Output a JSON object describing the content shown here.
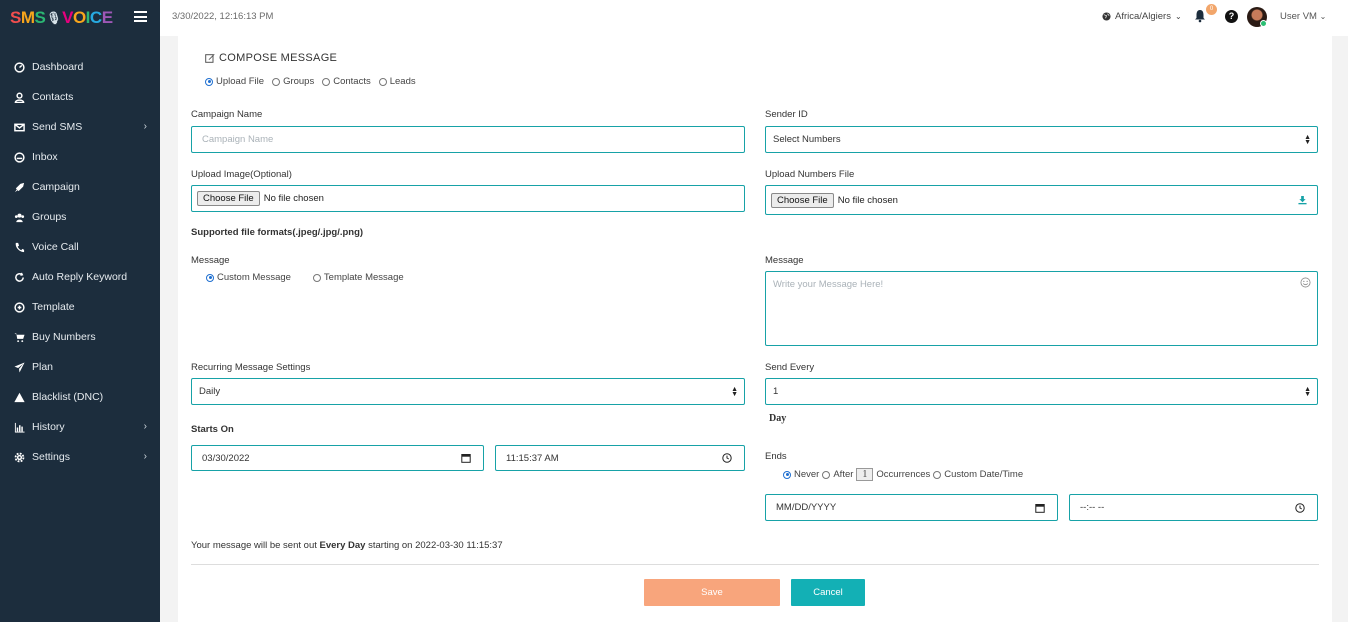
{
  "app": {
    "logo_letters": [
      "S",
      "M",
      "S",
      "V",
      "O",
      "I",
      "C",
      "E"
    ]
  },
  "header": {
    "datetime": "3/30/2022, 12:16:13 PM",
    "timezone": "Africa/Algiers",
    "notification_count": "0",
    "help_glyph": "?",
    "user_name": "User VM"
  },
  "sidebar": {
    "items": [
      {
        "label": "Dashboard",
        "icon": "dashboard-icon"
      },
      {
        "label": "Contacts",
        "icon": "user-icon"
      },
      {
        "label": "Send SMS",
        "icon": "envelope-icon",
        "chevron": "›"
      },
      {
        "label": "Inbox",
        "icon": "inbox-icon"
      },
      {
        "label": "Campaign",
        "icon": "rocket-icon"
      },
      {
        "label": "Groups",
        "icon": "users-icon"
      },
      {
        "label": "Voice Call",
        "icon": "phone-icon"
      },
      {
        "label": "Auto Reply Keyword",
        "icon": "refresh-icon"
      },
      {
        "label": "Template",
        "icon": "template-icon"
      },
      {
        "label": "Buy Numbers",
        "icon": "cart-icon"
      },
      {
        "label": "Plan",
        "icon": "paper-plane-icon"
      },
      {
        "label": "Blacklist (DNC)",
        "icon": "warning-icon"
      },
      {
        "label": "History",
        "icon": "bar-chart-icon",
        "chevron": "›"
      },
      {
        "label": "Settings",
        "icon": "gear-icon",
        "chevron": "›"
      }
    ]
  },
  "compose": {
    "title": "COMPOSE MESSAGE",
    "source_options": [
      "Upload File",
      "Groups",
      "Contacts",
      "Leads"
    ],
    "source_selected": "Upload File",
    "campaign_name_label": "Campaign Name",
    "campaign_name_placeholder": "Campaign Name",
    "sender_id_label": "Sender ID",
    "sender_id_value": "Select Numbers",
    "upload_image_label": "Upload Image(Optional)",
    "upload_numbers_label": "Upload Numbers File",
    "choose_file_label": "Choose File",
    "no_file_text": "No file chosen",
    "supported_formats": "Supported file formats(.jpeg/.jpg/.png)",
    "message_type_label": "Message",
    "message_types": [
      "Custom Message",
      "Template Message"
    ],
    "message_type_selected": "Custom Message",
    "message_label": "Message",
    "message_placeholder": "Write your Message Here!",
    "recurring_label": "Recurring Message Settings",
    "recurring_value": "Daily",
    "send_every_label": "Send Every",
    "send_every_value": "1",
    "send_every_unit": "Day",
    "starts_on_label": "Starts On",
    "start_date": "03/30/2022",
    "start_time": "11:15:37 AM",
    "ends_label": "Ends",
    "ends_options": [
      "Never",
      "After",
      "Occurrences",
      "Custom Date/Time"
    ],
    "ends_selected": "Never",
    "occurrences_value": "1",
    "end_date_placeholder": "MM/DD/YYYY",
    "end_time_placeholder": "--:-- --",
    "summary_prefix": "Your message will be sent out",
    "summary_bold": "Every Day",
    "summary_suffix": "starting on 2022-03-30 11:15:37",
    "save_label": "Save",
    "cancel_label": "Cancel"
  },
  "colors": {
    "sidebar_bg": "#1c2d3d",
    "field_border": "#17a2a7",
    "save_button": "#f8a57c",
    "cancel_button": "#13b0b5"
  }
}
